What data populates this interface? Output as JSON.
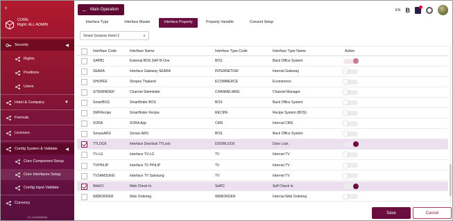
{
  "sidebar": {
    "org": "CORE",
    "right": "Right: ALL ADMIN",
    "items": [
      {
        "label": "Security",
        "arrow": "◀"
      },
      {
        "label": "Rights"
      },
      {
        "label": "Positions"
      },
      {
        "label": "Users"
      },
      {
        "label": "Hotel & Company",
        "arrow": "▼"
      },
      {
        "label": "Formula"
      },
      {
        "label": "Licenses"
      },
      {
        "label": "Config System & Validate",
        "arrow": "◀"
      },
      {
        "label": "Core Component Setup"
      },
      {
        "label": "Core Interfaces Setup"
      },
      {
        "label": "Config Input Validate"
      },
      {
        "label": "Currency"
      }
    ],
    "version": "5.1.1.BL00000000"
  },
  "header": {
    "main_operation": "Main Operation",
    "language": "EN",
    "b_label": "B"
  },
  "tabs": [
    "Interface Type",
    "Interface Master",
    "Interface Property",
    "Property Variable",
    "Consent Setup"
  ],
  "hotel_select": {
    "value": "Smart Sorasso Hotel 2"
  },
  "table": {
    "columns": [
      "Interface Code",
      "Interface Name",
      "Interface Type Code",
      "Interface Type Name",
      "Active"
    ],
    "rows": [
      {
        "code": "SAPB1",
        "name": "External BOS SAP B-One",
        "type_code": "BOS",
        "type_name": "Back Office System",
        "checked": false,
        "active": "partial"
      },
      {
        "code": "SEARA",
        "name": "Interface Gateway SEARA",
        "type_code": "INTERNETGW",
        "type_name": "Internet Gateway",
        "checked": false,
        "active": "off"
      },
      {
        "code": "SHOPEE",
        "name": "Shopee Thailand",
        "type_code": "ECOMMERCE",
        "type_name": "Ecommerce",
        "checked": false,
        "active": "off"
      },
      {
        "code": "SITEMINDER",
        "name": "Channel Siteminder",
        "type_code": "CHANNELMNG",
        "type_name": "Channel Manager",
        "checked": false,
        "active": "off"
      },
      {
        "code": "SmartBOS",
        "name": "Smartfinder BOS",
        "type_code": "BOS",
        "type_name": "Back Office System",
        "checked": false,
        "active": "off"
      },
      {
        "code": "SMFRecipe",
        "name": "Smartfinder Recipe",
        "type_code": "RECIPE",
        "type_name": "Recipe System (BOS)",
        "checked": false,
        "active": "off"
      },
      {
        "code": "SORA",
        "name": "SORA App",
        "type_code": "CMS",
        "type_name": "Internal CMS",
        "checked": false,
        "active": "off"
      },
      {
        "code": "SorassARS",
        "name": "Sorass ARS",
        "type_code": "BOS",
        "type_name": "Back Office System",
        "checked": false,
        "active": "off"
      },
      {
        "code": "TTLOCK",
        "name": "Interface Doorlock TTLock",
        "type_code": "DOORLOCK",
        "type_name": "Door Lock",
        "checked": true,
        "active": "on"
      },
      {
        "code": "TV-LG",
        "name": "Interface TV-LG",
        "type_code": "TV",
        "type_name": "Internet TV",
        "checked": false,
        "active": "off"
      },
      {
        "code": "TVPHILIP",
        "name": "Interface TV PHILIP",
        "type_code": "TV",
        "type_name": "Internet TV",
        "checked": false,
        "active": "off"
      },
      {
        "code": "TVSAMSUNG",
        "name": "Interface TV Samsung",
        "type_code": "TV",
        "type_name": "Internet TV",
        "checked": false,
        "active": "off"
      },
      {
        "code": "WebCI",
        "name": "Web Check In",
        "type_code": "SelfCI",
        "type_name": "Self Check In",
        "checked": true,
        "active": "on"
      },
      {
        "code": "WEBORDER",
        "name": "Web Ordering",
        "type_code": "WEBORDER",
        "type_name": "Internal Web Ordering",
        "checked": false,
        "active": "off"
      }
    ]
  },
  "buttons": {
    "save": "Save",
    "cancel": "Cancel"
  },
  "colors": {
    "primary": "#6a0d3f",
    "sidebar_top": "#b11a2f",
    "sidebar_bottom": "#57103f",
    "selected_row": "#ecdff0"
  }
}
